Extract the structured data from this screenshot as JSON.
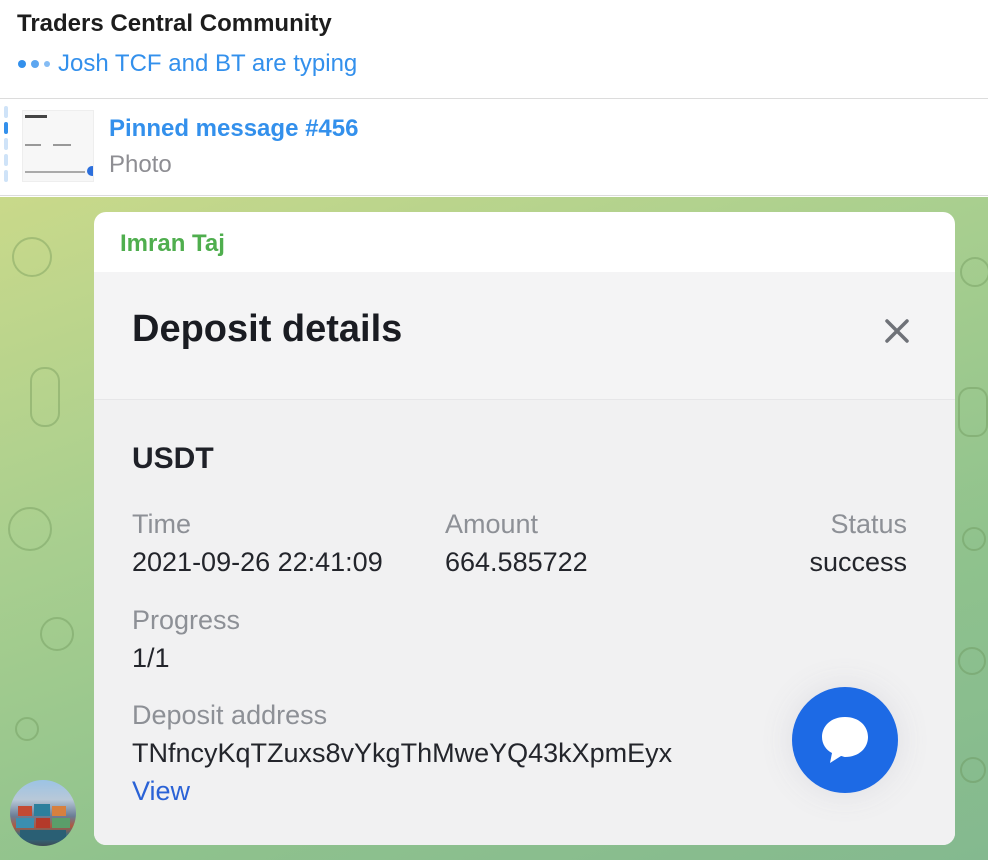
{
  "header": {
    "title": "Traders Central Community",
    "typing_status": "Josh TCF and BT are typing"
  },
  "pinned": {
    "title": "Pinned message #456",
    "subtitle": "Photo"
  },
  "message": {
    "sender": "Imran Taj",
    "photo": {
      "title": "Deposit details",
      "asset": "USDT",
      "time_label": "Time",
      "time_value": "2021-09-26 22:41:09",
      "amount_label": "Amount",
      "amount_value": "664.585722",
      "status_label": "Status",
      "status_value": "success",
      "progress_label": "Progress",
      "progress_value": "1/1",
      "address_label": "Deposit address",
      "address_value": "TNfncyKqTZuxs8vYkgThMweYQ43kXpmEyx",
      "view_link": "View"
    }
  },
  "colors": {
    "accent": "#3390ec",
    "sender": "#4fae4e",
    "chat_button": "#1d6ae5"
  },
  "icons": {
    "close": "close-icon",
    "chat": "chat-bubble-icon",
    "typing": "typing-dots-icon"
  }
}
